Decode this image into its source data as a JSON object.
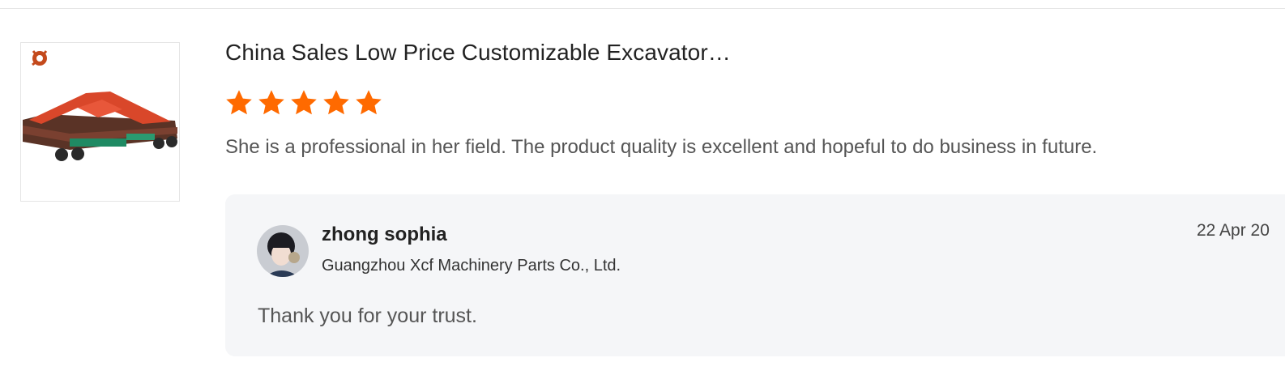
{
  "review": {
    "product_title": "China Sales Low Price Customizable Excavator…",
    "product_image_icon": "excavator-trailer-image",
    "rating": 5,
    "rating_max": 5,
    "star_color": "#ff6a00",
    "text": "She is a professional in her field. The product quality is excellent and hopeful to do business in future."
  },
  "reply": {
    "avatar_icon": "user-avatar",
    "name": "zhong sophia",
    "company": "Guangzhou Xcf Machinery Parts Co., Ltd.",
    "date": "22 Apr 20",
    "text": "Thank you for your trust."
  }
}
